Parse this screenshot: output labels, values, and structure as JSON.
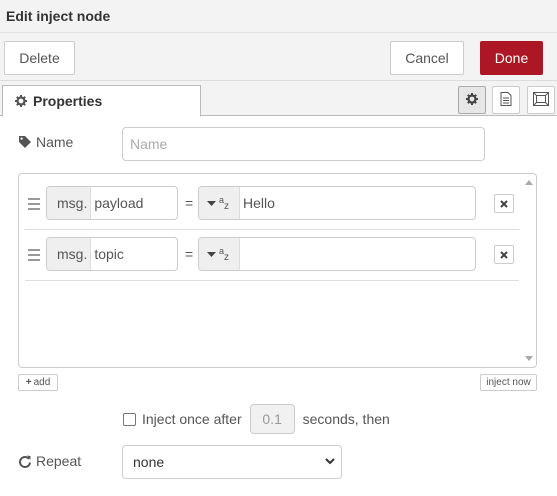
{
  "dialog": {
    "title": "Edit inject node",
    "delete_label": "Delete",
    "cancel_label": "Cancel",
    "done_label": "Done",
    "accent_color": "#ad1625"
  },
  "tabs": {
    "active_label": "Properties",
    "icons": [
      "gear-icon",
      "description-icon",
      "appearance-icon"
    ]
  },
  "form": {
    "name_label": "Name",
    "name_placeholder": "Name",
    "name_value": "",
    "properties": [
      {
        "prefix": "msg.",
        "key": "payload",
        "equals": "=",
        "type_icon": "string-az-icon",
        "value": "Hello"
      },
      {
        "prefix": "msg.",
        "key": "topic",
        "equals": "=",
        "type_icon": "string-az-icon",
        "value": ""
      }
    ],
    "add_label": "add",
    "inject_now_label": "inject now",
    "inject_once_label": "Inject once after",
    "inject_once_checked": false,
    "inject_once_value": "0.1",
    "seconds_label": "seconds, then",
    "repeat_label": "Repeat",
    "repeat_value": "none"
  }
}
